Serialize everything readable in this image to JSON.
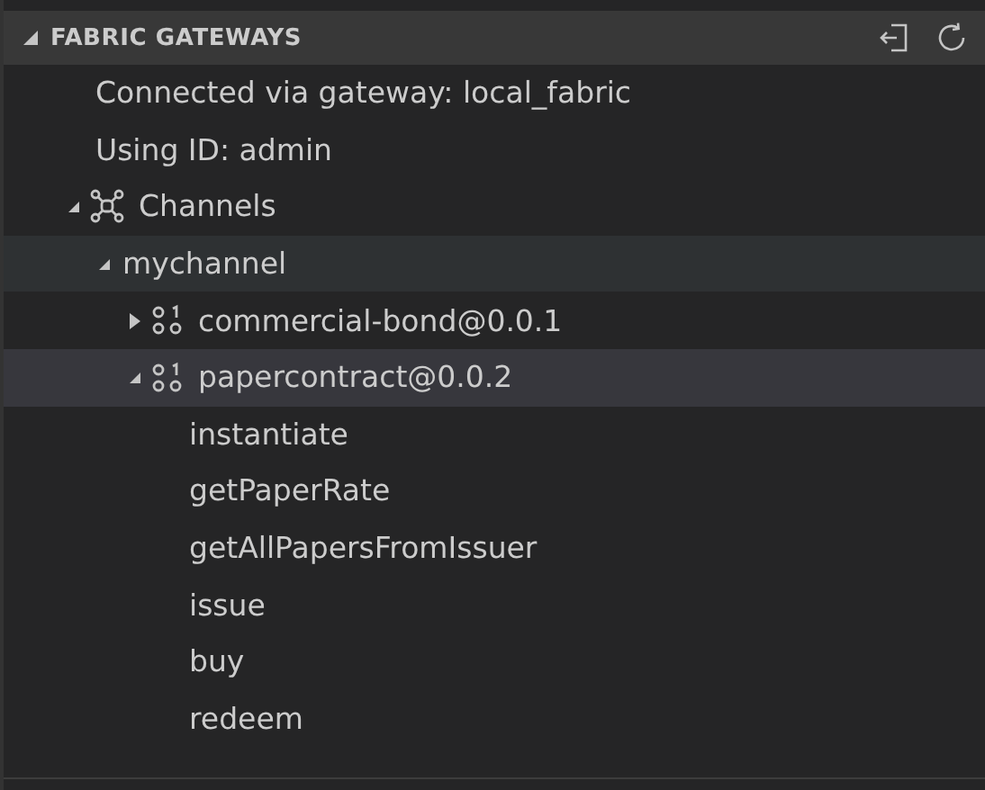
{
  "panel": {
    "title": "FABRIC GATEWAYS",
    "expanded": true
  },
  "tree": [
    {
      "kind": "info",
      "label": "Connected via gateway: local_fabric",
      "selected": false
    },
    {
      "kind": "info",
      "label": "Using ID: admin",
      "selected": false
    },
    {
      "kind": "channels",
      "label": "Channels",
      "expanded": true,
      "selected": false,
      "children": [
        {
          "kind": "channel",
          "label": "mychannel",
          "expanded": true,
          "selected": false,
          "hovered": true,
          "children": [
            {
              "kind": "contract",
              "label": "commercial-bond@0.0.1",
              "expanded": false,
              "selected": false
            },
            {
              "kind": "contract",
              "label": "papercontract@0.0.2",
              "expanded": true,
              "selected": true,
              "children": [
                {
                  "kind": "method",
                  "label": "instantiate",
                  "selected": false
                },
                {
                  "kind": "method",
                  "label": "getPaperRate",
                  "selected": false
                },
                {
                  "kind": "method",
                  "label": "getAllPapersFromIssuer",
                  "selected": false
                },
                {
                  "kind": "method",
                  "label": "issue",
                  "selected": false
                },
                {
                  "kind": "method",
                  "label": "buy",
                  "selected": false
                },
                {
                  "kind": "method",
                  "label": "redeem",
                  "selected": false
                }
              ]
            }
          ]
        }
      ]
    }
  ]
}
